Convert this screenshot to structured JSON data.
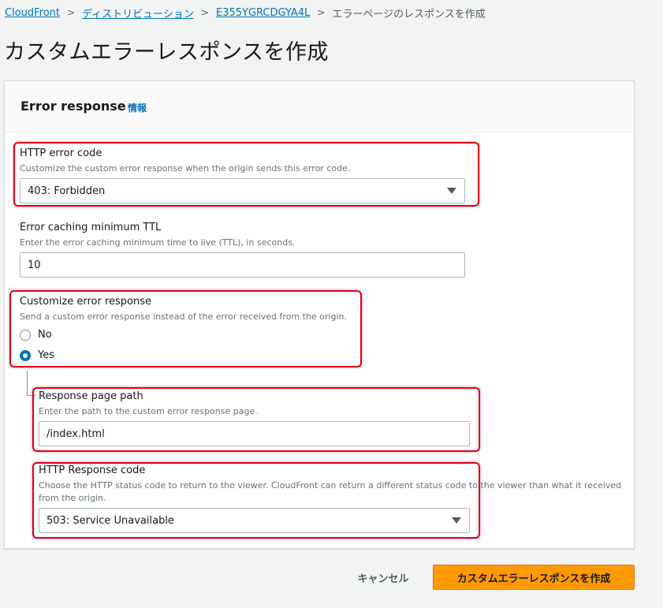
{
  "breadcrumb": {
    "items": [
      "CloudFront",
      "ディストリビューション",
      "E355YGRCDGYA4L"
    ],
    "current": "エラーページのレスポンスを作成",
    "separator": ">"
  },
  "page": {
    "title": "カスタムエラーレスポンスを作成"
  },
  "panel": {
    "title": "Error response",
    "info": "情報"
  },
  "http_error_code": {
    "label": "HTTP error code",
    "description": "Customize the custom error response when the origin sends this error code.",
    "value": "403: Forbidden"
  },
  "ttl": {
    "label": "Error caching minimum TTL",
    "description": "Enter the error caching minimum time to live (TTL), in seconds.",
    "value": "10"
  },
  "customize": {
    "label": "Customize error response",
    "description": "Send a custom error response instead of the error received from the origin.",
    "options": [
      "No",
      "Yes"
    ],
    "selected": "Yes"
  },
  "response_page_path": {
    "label": "Response page path",
    "description": "Enter the path to the custom error response page.",
    "value": "/index.html"
  },
  "http_response_code": {
    "label": "HTTP Response code",
    "description_line1": "Choose the HTTP status code to return to the viewer. CloudFront can return a different status code to the viewer than what it received",
    "description_line2": "from the origin.",
    "value": "503: Service Unavailable"
  },
  "actions": {
    "cancel": "キャンセル",
    "create": "カスタムエラーレスポンスを作成"
  },
  "colors": {
    "link": "#0073bb",
    "primary_button": "#ff9900",
    "highlight": "#e0001b",
    "background": "#f2f3f3"
  }
}
